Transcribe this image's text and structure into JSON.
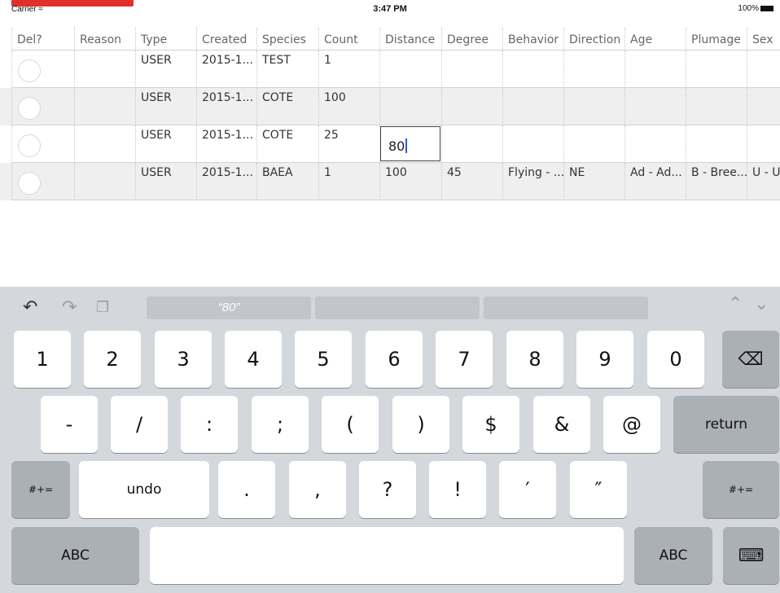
{
  "status_bar": {
    "carrier": "Carrier",
    "time": "3:47 PM",
    "battery": "100%"
  },
  "grid": {
    "columns": [
      "Del?",
      "Reason",
      "Type",
      "Created",
      "Species",
      "Count",
      "Distance",
      "Degree",
      "Behavior",
      "Direction",
      "Age",
      "Plumage",
      "Sex"
    ],
    "rows": [
      {
        "type": "USER",
        "created": "2015-1...",
        "species": "TEST",
        "count": "1",
        "distance": "",
        "degree": "",
        "behavior": "",
        "direction": "",
        "age": "",
        "plumage": "",
        "sex": ""
      },
      {
        "type": "USER",
        "created": "2015-1...",
        "species": "COTE",
        "count": "100",
        "distance": "",
        "degree": "",
        "behavior": "",
        "direction": "",
        "age": "",
        "plumage": "",
        "sex": ""
      },
      {
        "type": "USER",
        "created": "2015-1...",
        "species": "COTE",
        "count": "25",
        "distance": "",
        "degree": "",
        "behavior": "",
        "direction": "",
        "age": "",
        "plumage": "",
        "sex": ""
      },
      {
        "type": "USER",
        "created": "2015-1...",
        "species": "BAEA",
        "count": "1",
        "distance": "100",
        "degree": "45",
        "behavior": "Flying - ...",
        "direction": "NE",
        "age": "Ad - Ad...",
        "plumage": "B - Bree...",
        "sex": "U - Ur"
      }
    ],
    "editing_value": "80"
  },
  "keyboard": {
    "suggestion": "“80”",
    "toolbar_icons": [
      "undo-icon",
      "redo-icon",
      "paste-icon"
    ],
    "row1": [
      "1",
      "2",
      "3",
      "4",
      "5",
      "6",
      "7",
      "8",
      "9",
      "0"
    ],
    "row2": [
      "-",
      "/",
      ":",
      ";",
      "(",
      ")",
      "$",
      "&",
      "@"
    ],
    "return": "return",
    "row3": [
      "undo",
      ".",
      ",",
      "?",
      "!",
      "′",
      "″"
    ],
    "symbols": "#+=",
    "abc": "ABC"
  }
}
